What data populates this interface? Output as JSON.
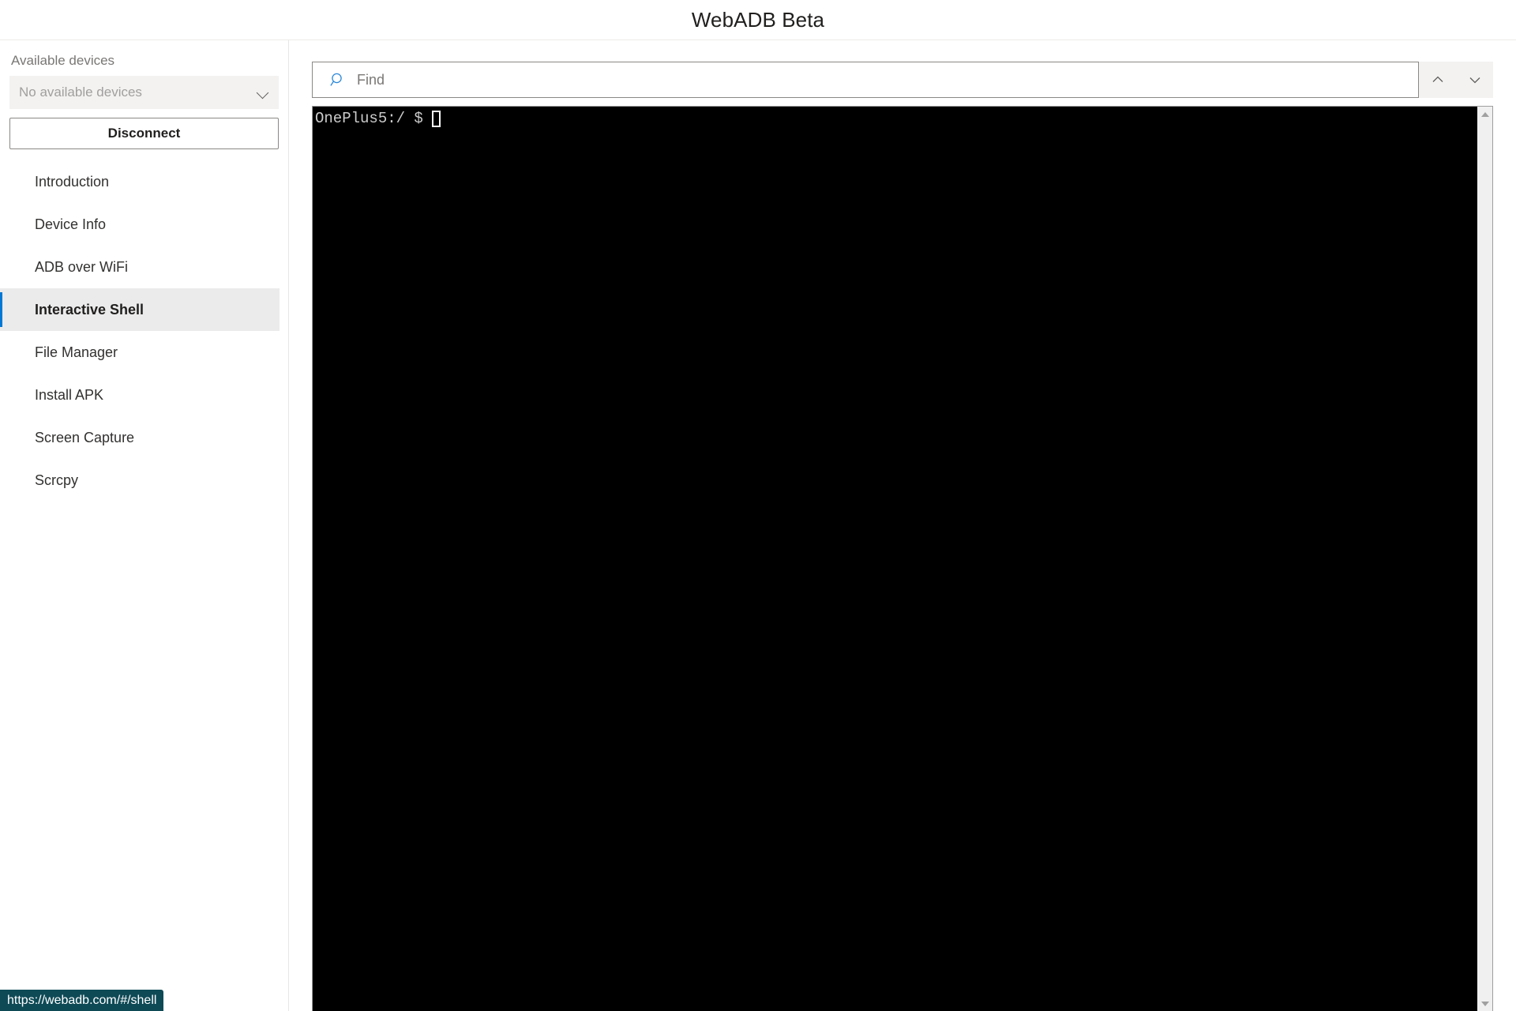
{
  "header": {
    "title": "WebADB Beta"
  },
  "sidebar": {
    "devices_label": "Available devices",
    "device_select": {
      "value": "No available devices",
      "icon": "chevron-down-icon"
    },
    "disconnect_label": "Disconnect",
    "items": [
      {
        "label": "Introduction",
        "selected": false
      },
      {
        "label": "Device Info",
        "selected": false
      },
      {
        "label": "ADB over WiFi",
        "selected": false
      },
      {
        "label": "Interactive Shell",
        "selected": true
      },
      {
        "label": "File Manager",
        "selected": false
      },
      {
        "label": "Install APK",
        "selected": false
      },
      {
        "label": "Screen Capture",
        "selected": false
      },
      {
        "label": "Scrcpy",
        "selected": false
      }
    ]
  },
  "find": {
    "icon": "search-icon",
    "placeholder": "Find",
    "value": "",
    "prev_icon": "chevron-up-icon",
    "next_icon": "chevron-down-icon"
  },
  "terminal": {
    "prompt": "OnePlus5:/ $",
    "lines": [
      "OnePlus5:/ $"
    ],
    "cursor": "block-outline",
    "background": "#000000",
    "foreground": "#cccccc",
    "scrollbar": {
      "up_icon": "scroll-up-arrow-icon",
      "down_icon": "scroll-down-arrow-icon"
    }
  },
  "statusbar": {
    "url": "https://webadb.com/#/shell"
  },
  "colors": {
    "accent": "#0078d4",
    "selected_bg": "#ebebeb",
    "status_bg": "#0e4a56"
  }
}
